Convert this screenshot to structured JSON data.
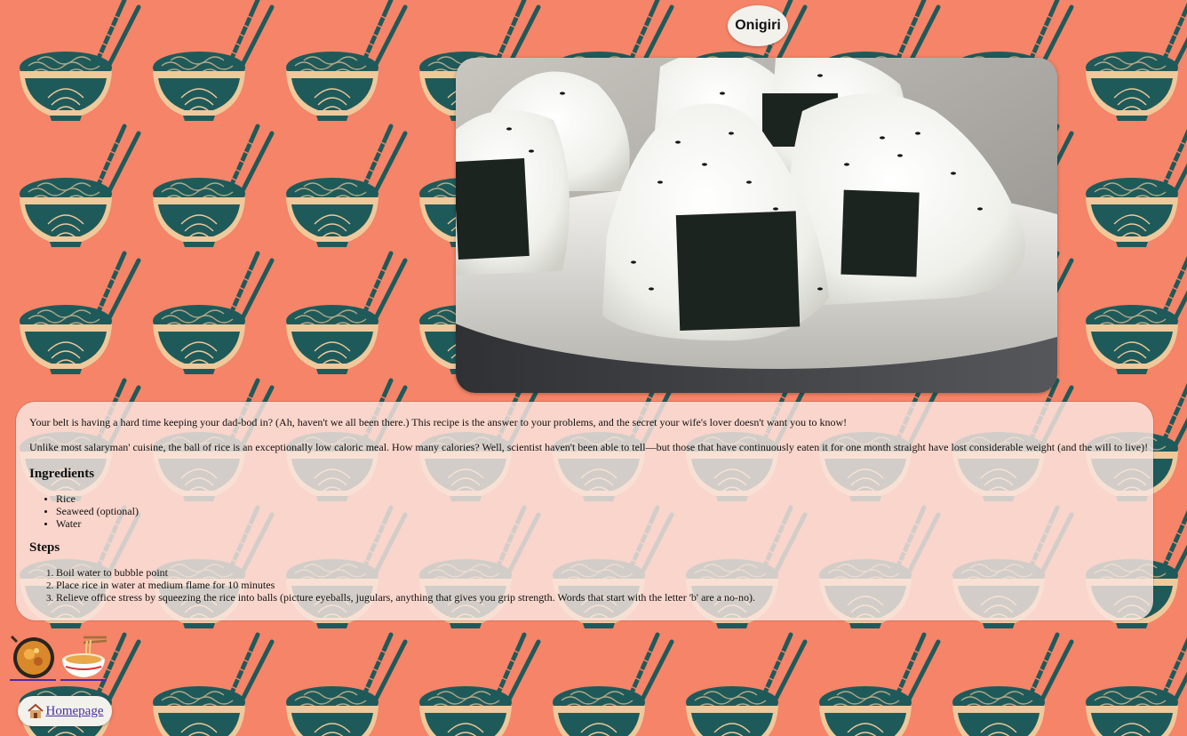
{
  "page": {
    "title": "Onigiri"
  },
  "colors": {
    "background": "#f58468",
    "bowl": "#1f5a5a",
    "bowl_light": "#efc99b",
    "card": "#fae6e1",
    "link": "#4a2fa0"
  },
  "hero": {
    "icon": "onigiri-photo"
  },
  "intro": {
    "paragraph1": "Your belt is having a hard time keeping your dad-bod in? (Ah, haven't we all been there.) This recipe is the answer to your problems, and the secret your wife's lover doesn't want you to know!",
    "paragraph2": "Unlike most salaryman' cuisine, the ball of rice is an exceptionally low caloric meal. How many calories? Well, scientist haven't been able to tell—but those that have continuously eaten it for one month straight have lost considerable weight (and the will to live)!"
  },
  "ingredients": {
    "heading": "Ingredients",
    "items": [
      "Rice",
      "Seaweed (optional)",
      "Water"
    ]
  },
  "steps": {
    "heading": "Steps",
    "items": [
      "Boil water to bubble point",
      "Place rice in water at medium flame for 10 minutes",
      "Relieve office stress by squeezing the rice into balls (picture eyeballs, jugulars, anything that gives you grip strength. Words that start with the letter 'b' are a no-no)."
    ]
  },
  "thumbnails": [
    {
      "icon": "curry-pan-icon"
    },
    {
      "icon": "ramen-bowl-icon"
    }
  ],
  "home": {
    "label": "Homepage",
    "icon": "house-icon"
  }
}
